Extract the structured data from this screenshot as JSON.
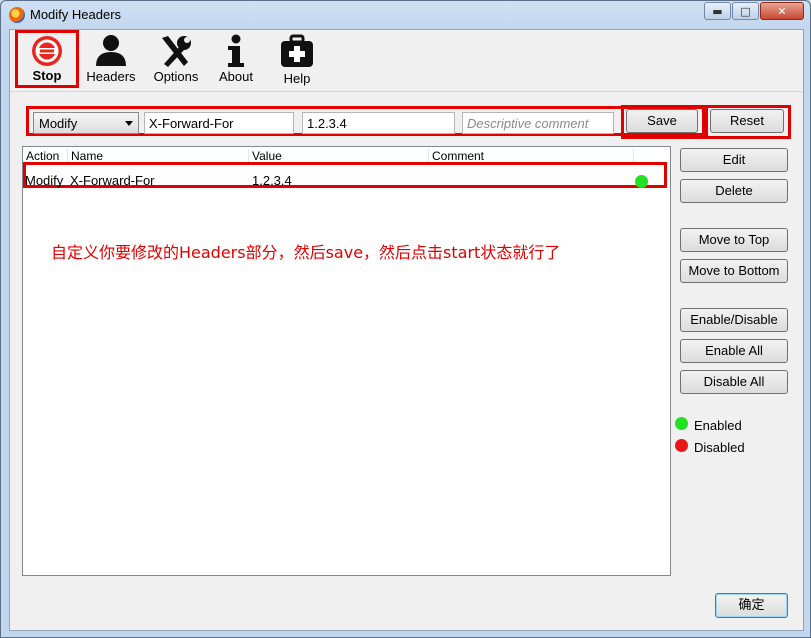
{
  "window": {
    "title": "Modify Headers"
  },
  "window_buttons": {
    "minimize": "▬",
    "maximize": "□",
    "close": "✕"
  },
  "toolbar": {
    "stop": "Stop",
    "headers": "Headers",
    "options": "Options",
    "about": "About",
    "help": "Help"
  },
  "editor": {
    "action": "Modify",
    "name": "X-Forward-For",
    "value": "1.2.3.4",
    "comment_placeholder": "Descriptive comment",
    "save": "Save",
    "reset": "Reset"
  },
  "table": {
    "columns": [
      "Action",
      "Name",
      "Value",
      "Comment"
    ],
    "rows": [
      {
        "action": "Modify",
        "name": "X-Forward-For",
        "value": "1.2.3.4",
        "comment": "",
        "enabled": true
      }
    ]
  },
  "annotation": "自定义你要修改的Headers部分，然后save，然后点击start状态就行了",
  "side_buttons": {
    "edit": "Edit",
    "delete": "Delete",
    "move_top": "Move to Top",
    "move_bottom": "Move to Bottom",
    "enable_disable": "Enable/Disable",
    "enable_all": "Enable All",
    "disable_all": "Disable All"
  },
  "legend": {
    "enabled": "Enabled",
    "disabled": "Disabled"
  },
  "footer": {
    "ok": "确定"
  },
  "colors": {
    "enabled": "#22e022",
    "disabled": "#e81818",
    "highlight": "#e00000"
  }
}
